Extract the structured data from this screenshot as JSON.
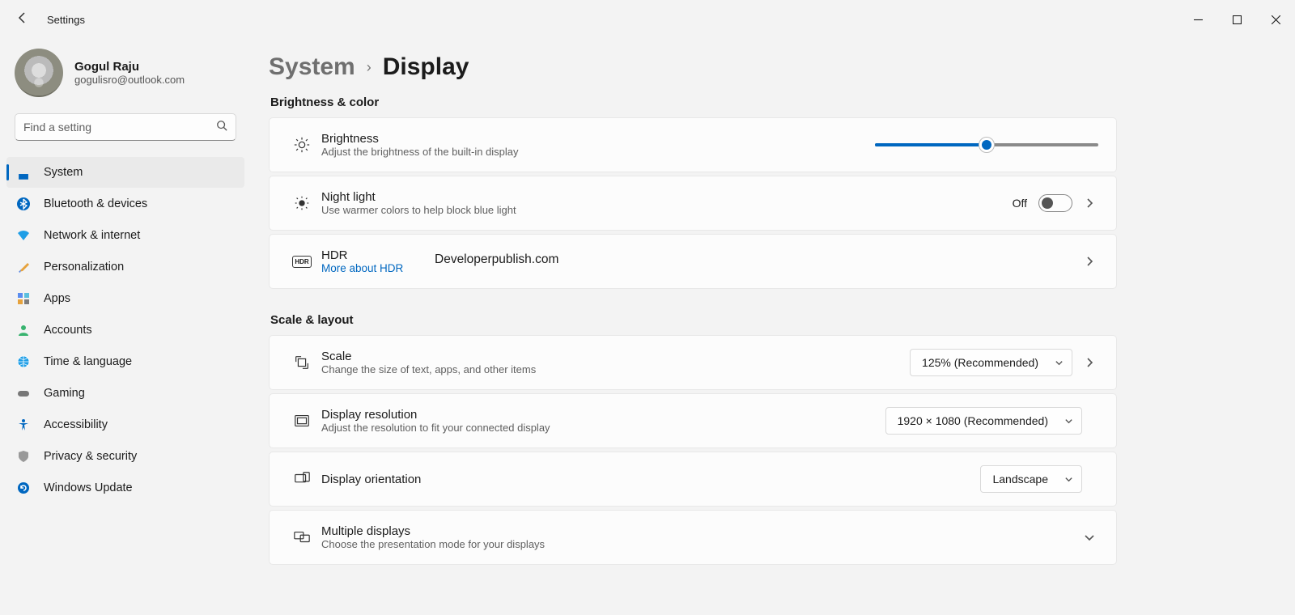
{
  "window": {
    "title": "Settings"
  },
  "profile": {
    "name": "Gogul Raju",
    "email": "gogulisro@outlook.com"
  },
  "search": {
    "placeholder": "Find a setting"
  },
  "sidebar": {
    "items": [
      {
        "label": "System",
        "icon": "🖥️",
        "active": true
      },
      {
        "label": "Bluetooth & devices",
        "icon": "bt",
        "active": false
      },
      {
        "label": "Network & internet",
        "icon": "📶",
        "active": false
      },
      {
        "label": "Personalization",
        "icon": "🖌️",
        "active": false
      },
      {
        "label": "Apps",
        "icon": "▦",
        "active": false
      },
      {
        "label": "Accounts",
        "icon": "👤",
        "active": false
      },
      {
        "label": "Time & language",
        "icon": "🌐",
        "active": false
      },
      {
        "label": "Gaming",
        "icon": "🎮",
        "active": false
      },
      {
        "label": "Accessibility",
        "icon": "acc",
        "active": false
      },
      {
        "label": "Privacy & security",
        "icon": "🛡️",
        "active": false
      },
      {
        "label": "Windows Update",
        "icon": "🔄",
        "active": false
      }
    ]
  },
  "breadcrumb": {
    "parent": "System",
    "current": "Display"
  },
  "sections": {
    "brightness_color": {
      "header": "Brightness & color",
      "brightness": {
        "title": "Brightness",
        "sub": "Adjust the brightness of the built-in display",
        "percent": 50
      },
      "night_light": {
        "title": "Night light",
        "sub": "Use warmer colors to help block blue light",
        "state_label": "Off",
        "on": false
      },
      "hdr": {
        "title": "HDR",
        "link": "More about HDR"
      }
    },
    "scale_layout": {
      "header": "Scale & layout",
      "scale": {
        "title": "Scale",
        "sub": "Change the size of text, apps, and other items",
        "value": "125% (Recommended)"
      },
      "resolution": {
        "title": "Display resolution",
        "sub": "Adjust the resolution to fit your connected display",
        "value": "1920 × 1080 (Recommended)"
      },
      "orientation": {
        "title": "Display orientation",
        "value": "Landscape"
      },
      "multiple": {
        "title": "Multiple displays",
        "sub": "Choose the presentation mode for your displays"
      }
    }
  },
  "watermark": "Developerpublish.com"
}
